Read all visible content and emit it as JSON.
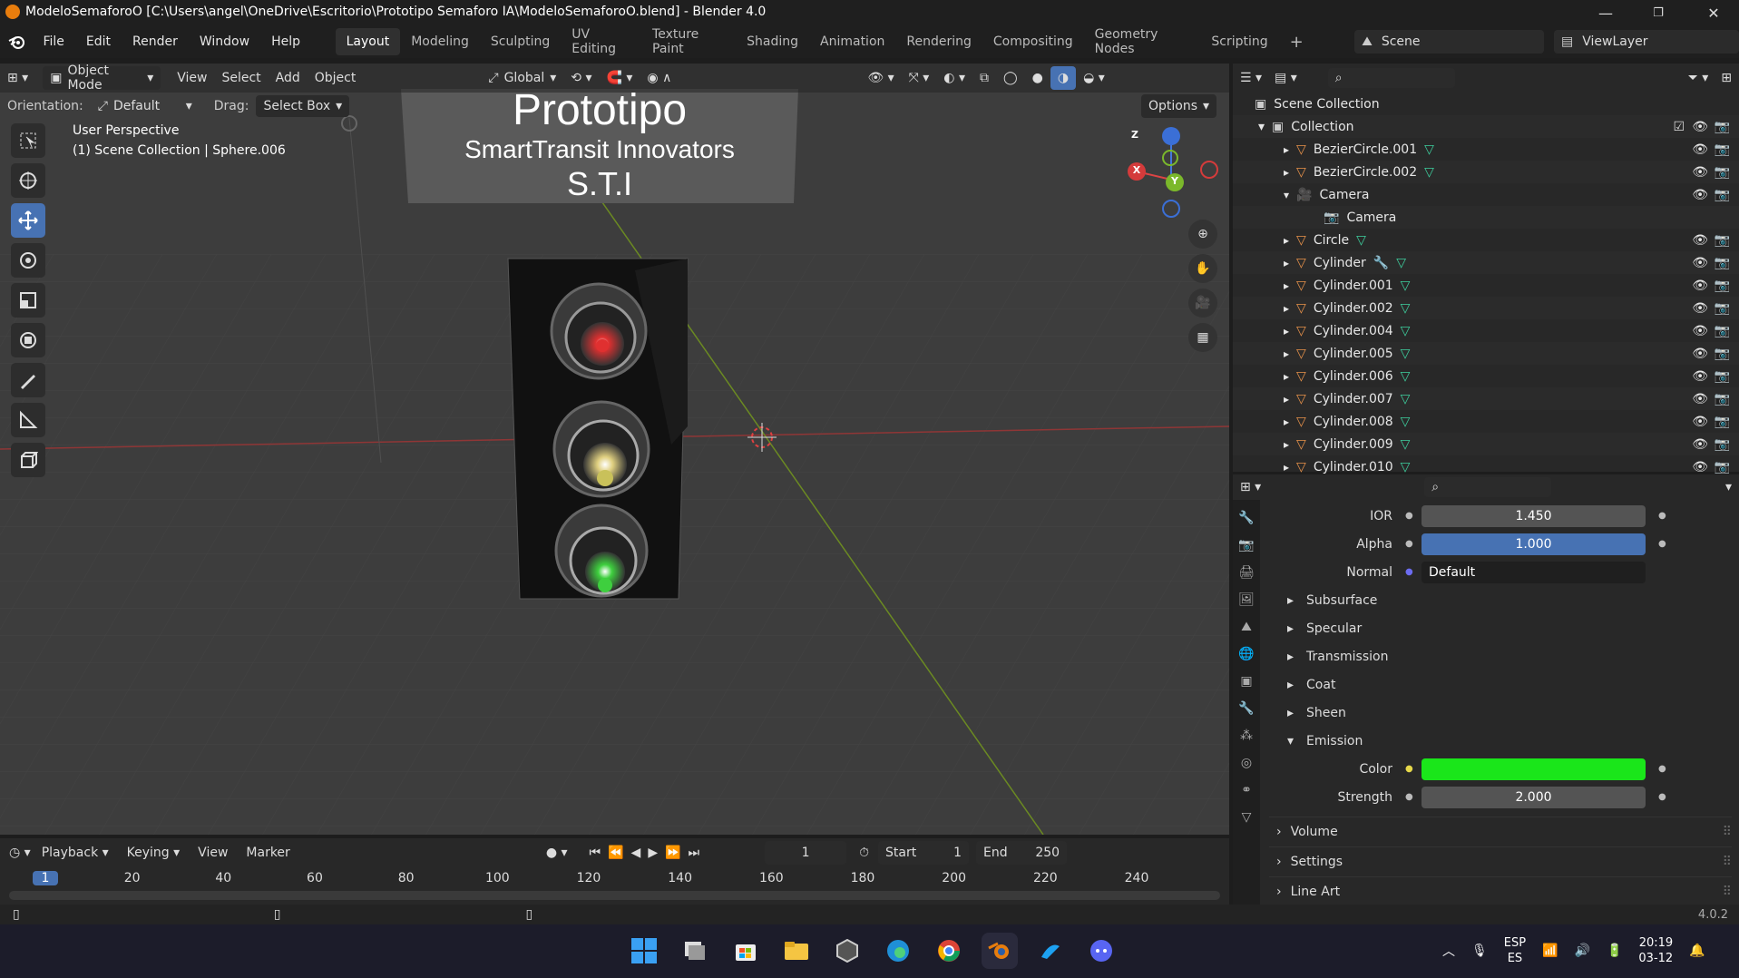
{
  "titlebar": {
    "title": "ModeloSemaforoO [C:\\Users\\angel\\OneDrive\\Escritorio\\Prototipo Semaforo IA\\ModeloSemaforoO.blend] - Blender 4.0",
    "minimize": "—",
    "maximize": "❐",
    "close": "✕"
  },
  "menu": {
    "items": [
      "File",
      "Edit",
      "Render",
      "Window",
      "Help"
    ],
    "workspaces": [
      "Layout",
      "Modeling",
      "Sculpting",
      "UV Editing",
      "Texture Paint",
      "Shading",
      "Animation",
      "Rendering",
      "Compositing",
      "Geometry Nodes",
      "Scripting"
    ],
    "add_workspace": "+",
    "scene": "Scene",
    "view_layer": "ViewLayer"
  },
  "viewport_header": {
    "mode": "Object Mode",
    "menus": [
      "View",
      "Select",
      "Add",
      "Object"
    ],
    "transform": "Global",
    "orientation_label": "Orientation:",
    "orientation_value": "Default",
    "drag_label": "Drag:",
    "drag_value": "Select Box",
    "options": "Options"
  },
  "viewport": {
    "perspective": "User Perspective",
    "context": "(1) Scene Collection | Sphere.006",
    "banner_line1": "Prototipo",
    "banner_line2": "SmartTransit Innovators",
    "banner_line3": "S.T.I",
    "gizmo_x": "X",
    "gizmo_y": "Y",
    "gizmo_z": "Z",
    "colors": {
      "red_light": "#e03030",
      "yellow_light": "#e0d080",
      "green_light": "#3ecf3e"
    }
  },
  "outliner": {
    "root": "Scene Collection",
    "collection": "Collection",
    "items": [
      {
        "name": "BezierCircle.001",
        "type": "curve",
        "expanded": false
      },
      {
        "name": "BezierCircle.002",
        "type": "curve",
        "expanded": false
      },
      {
        "name": "Camera",
        "type": "camera",
        "expanded": true
      },
      {
        "name": "Camera",
        "type": "camera-data",
        "child": true
      },
      {
        "name": "Circle",
        "type": "mesh",
        "expanded": false
      },
      {
        "name": "Cylinder",
        "type": "mesh",
        "expanded": false,
        "modifier": true
      },
      {
        "name": "Cylinder.001",
        "type": "mesh",
        "expanded": false
      },
      {
        "name": "Cylinder.002",
        "type": "mesh",
        "expanded": false
      },
      {
        "name": "Cylinder.004",
        "type": "mesh",
        "expanded": false
      },
      {
        "name": "Cylinder.005",
        "type": "mesh",
        "expanded": false
      },
      {
        "name": "Cylinder.006",
        "type": "mesh",
        "expanded": false
      },
      {
        "name": "Cylinder.007",
        "type": "mesh",
        "expanded": false
      },
      {
        "name": "Cylinder.008",
        "type": "mesh",
        "expanded": false
      },
      {
        "name": "Cylinder.009",
        "type": "mesh",
        "expanded": false
      },
      {
        "name": "Cylinder.010",
        "type": "mesh",
        "expanded": false
      }
    ]
  },
  "properties": {
    "ior_label": "IOR",
    "ior_value": "1.450",
    "alpha_label": "Alpha",
    "alpha_value": "1.000",
    "alpha_fill": 1.0,
    "normal_label": "Normal",
    "normal_value": "Default",
    "panels": [
      "Subsurface",
      "Specular",
      "Transmission",
      "Coat",
      "Sheen"
    ],
    "emission": "Emission",
    "color_label": "Color",
    "emission_color": "#1ae61a",
    "strength_label": "Strength",
    "strength_value": "2.000",
    "sections": [
      "Volume",
      "Settings",
      "Line Art"
    ]
  },
  "timeline": {
    "menus": [
      "Playback",
      "Keying",
      "View",
      "Marker"
    ],
    "current_frame": "1",
    "start_label": "Start",
    "start_value": "1",
    "end_label": "End",
    "end_value": "250",
    "ticks": [
      "1",
      "20",
      "40",
      "60",
      "80",
      "100",
      "120",
      "140",
      "160",
      "180",
      "200",
      "220",
      "240"
    ]
  },
  "statusbar": {
    "version": "4.0.2"
  },
  "taskbar": {
    "lang_top": "ESP",
    "lang_bottom": "ES",
    "time": "20:19",
    "date": "03-12"
  }
}
